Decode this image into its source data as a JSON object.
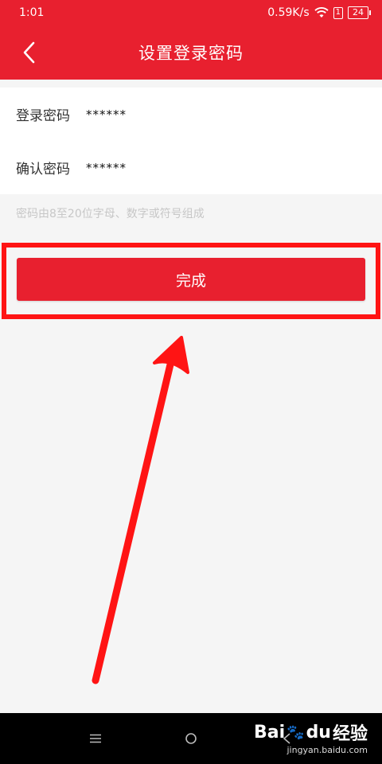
{
  "status_bar": {
    "time": "1:01",
    "network_speed": "0.59K/s",
    "sim_label": "1",
    "battery": "24"
  },
  "header": {
    "title": "设置登录密码",
    "back_icon": "chevron-left-icon"
  },
  "form": {
    "password_label": "登录密码",
    "password_value": "******",
    "confirm_label": "确认密码",
    "confirm_value": "******"
  },
  "hint": "密码由8至20位字母、数字或符号组成",
  "done_button": "完成",
  "colors": {
    "brand_red": "#e8202f",
    "annotation_red": "#ff1414",
    "background": "#f5f5f5",
    "hint": "#c7c7c7"
  },
  "system_nav": {
    "menu_icon": "≡",
    "home_icon": "○",
    "back_icon": "<"
  },
  "watermark": {
    "brand": "Bai",
    "brand_suffix": "du",
    "product": "经验",
    "url": "jingyan.baidu.com"
  }
}
